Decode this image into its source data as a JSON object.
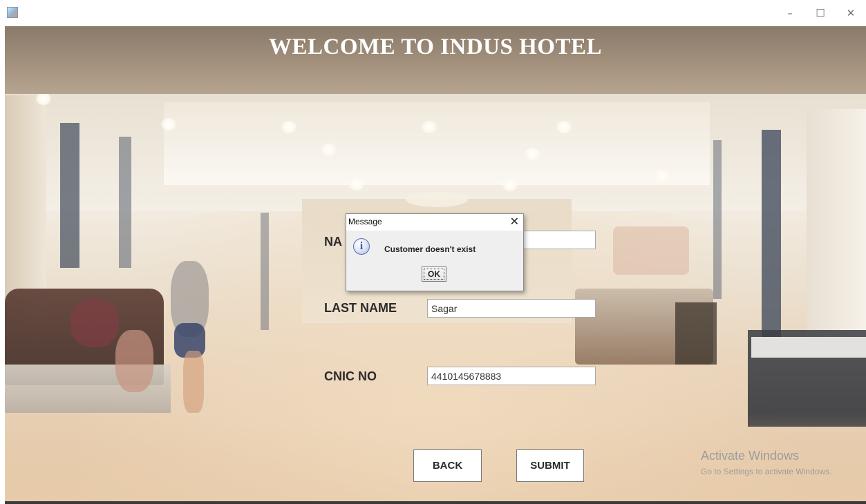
{
  "window": {
    "minimize_glyph": "–",
    "maximize_glyph": "☐",
    "close_glyph": "✕"
  },
  "header": {
    "title": "WELCOME TO INDUS HOTEL"
  },
  "form": {
    "name_label_visible": "NA",
    "name_value": "",
    "last_name_label": "LAST NAME",
    "last_name_value": "Sagar",
    "cnic_label": "CNIC NO",
    "cnic_value": "4410145678883",
    "back_label": "BACK",
    "submit_label": "SUBMIT"
  },
  "watermark": {
    "line1": "Activate Windows",
    "line2": "Go to Settings to activate Windows."
  },
  "dialog": {
    "title": "Message",
    "close_glyph": "✕",
    "icon": "info-icon",
    "icon_glyph": "i",
    "message": "Customer doesn't exist",
    "ok_label": "OK"
  },
  "colors": {
    "header_strip": "#a3917d",
    "title_text": "#ffffff",
    "dialog_bg": "#efefef",
    "info_icon": "#3b56b0"
  }
}
